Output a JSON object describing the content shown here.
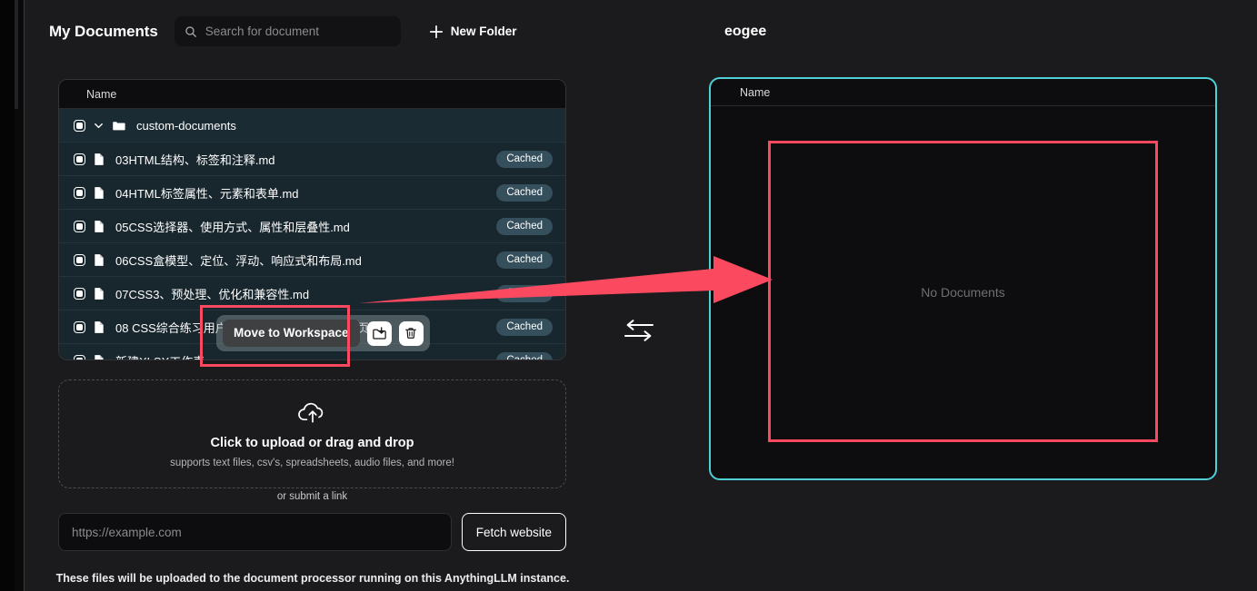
{
  "header": {
    "title": "My Documents",
    "search_placeholder": "Search for document",
    "new_folder_label": "New Folder"
  },
  "workspace": {
    "title": "eogee",
    "table_header": "Name",
    "empty_label": "No Documents"
  },
  "file_table": {
    "header": "Name",
    "rows": [
      {
        "name": "custom-documents",
        "type": "folder",
        "badge": ""
      },
      {
        "name": "03HTML结构、标签和注释.md",
        "type": "file",
        "badge": "Cached"
      },
      {
        "name": "04HTML标签属性、元素和表单.md",
        "type": "file",
        "badge": "Cached"
      },
      {
        "name": "05CSS选择器、使用方式、属性和层叠性.md",
        "type": "file",
        "badge": "Cached"
      },
      {
        "name": "06CSS盒模型、定位、浮动、响应式和布局.md",
        "type": "file",
        "badge": "Cached"
      },
      {
        "name": "07CSS3、预处理、优化和兼容性.md",
        "type": "file",
        "badge": "Cached"
      },
      {
        "name": "08 CSS综合练习用户登录、后台管理、前台首页.md",
        "type": "file",
        "badge": "Cached"
      },
      {
        "name": "新建XLSX工作表.csv",
        "type": "file",
        "badge": "Cached"
      }
    ]
  },
  "row_actions": {
    "tooltip": "Move to Workspace",
    "move_icon": "folder-move-icon",
    "delete_icon": "trash-icon"
  },
  "upload": {
    "title": "Click to upload or drag and drop",
    "subtitle": "supports text files, csv's, spreadsheets, audio files, and more!",
    "or_label": "or submit a link",
    "link_placeholder": "https://example.com",
    "fetch_label": "Fetch website",
    "footnote": "These files will be uploaded to the document processor running on this AnythingLLM instance."
  },
  "swap": {
    "icon": "swap-horizontal-arrows-icon"
  },
  "colors": {
    "page_bg": "#1b1b1e",
    "panel_bg": "#0d0d0f",
    "row_bg": "#18262e",
    "badge_bg": "#35505c",
    "workspace_border": "#4fcfd6",
    "annotation_red": "#fb4a5f"
  }
}
